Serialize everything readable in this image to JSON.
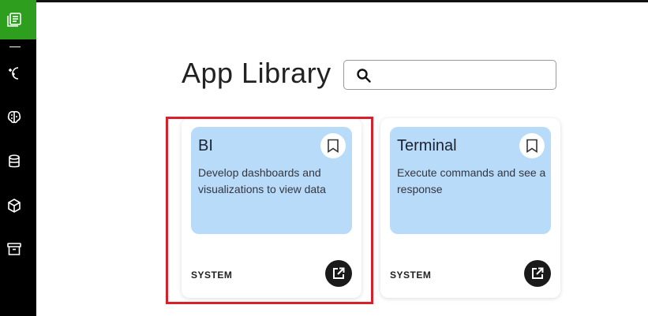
{
  "page": {
    "title": "App Library"
  },
  "search": {
    "placeholder": "",
    "value": ""
  },
  "sidebar": {
    "active_color": "#2e9e1f",
    "items": [
      {
        "icon": "library-icon",
        "active": true
      },
      {
        "icon": "sparkle-moon-icon",
        "active": false
      },
      {
        "icon": "brain-icon",
        "active": false
      },
      {
        "icon": "database-icon",
        "active": false
      },
      {
        "icon": "cube-icon",
        "active": false
      },
      {
        "icon": "archive-icon",
        "active": false
      }
    ]
  },
  "cards": [
    {
      "name": "BI",
      "description": "Develop dashboards and visualizations to view data",
      "tag": "SYSTEM",
      "highlighted": true
    },
    {
      "name": "Terminal",
      "description": "Execute commands and see a response",
      "tag": "SYSTEM",
      "highlighted": false
    }
  ],
  "colors": {
    "card_bg": "#b8dbf9",
    "highlight": "#d8202a"
  }
}
